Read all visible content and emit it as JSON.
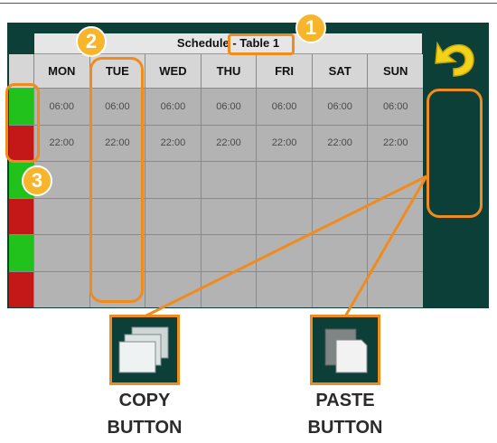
{
  "schedule": {
    "title": "Schedule - Table 1",
    "days": [
      "MON",
      "TUE",
      "WED",
      "THU",
      "FRI",
      "SAT",
      "SUN"
    ],
    "rows": [
      {
        "switch": "green",
        "times": [
          "06:00",
          "06:00",
          "06:00",
          "06:00",
          "06:00",
          "06:00",
          "06:00"
        ]
      },
      {
        "switch": "red",
        "times": [
          "22:00",
          "22:00",
          "22:00",
          "22:00",
          "22:00",
          "22:00",
          "22:00"
        ]
      },
      {
        "switch": "green",
        "times": [
          "",
          "",
          "",
          "",
          "",
          "",
          ""
        ]
      },
      {
        "switch": "red",
        "times": [
          "",
          "",
          "",
          "",
          "",
          "",
          ""
        ]
      },
      {
        "switch": "green",
        "times": [
          "",
          "",
          "",
          "",
          "",
          "",
          ""
        ]
      },
      {
        "switch": "red",
        "times": [
          "",
          "",
          "",
          "",
          "",
          "",
          ""
        ]
      }
    ]
  },
  "markers": {
    "one": "1",
    "two": "2",
    "three": "3"
  },
  "callouts": {
    "copy_line1": "COPY",
    "copy_line2": "BUTTON",
    "paste_line1": "PASTE",
    "paste_line2": "BUTTON"
  },
  "colors": {
    "panel": "#0b3f38",
    "highlight": "#f08b1e",
    "marker": "#f7b52c",
    "on": "#22c21c",
    "off": "#c41818",
    "undo_arrow": "#f2d21c"
  },
  "icons": {
    "undo": "undo-arrow-icon",
    "copy": "copy-icon",
    "paste": "paste-icon"
  }
}
